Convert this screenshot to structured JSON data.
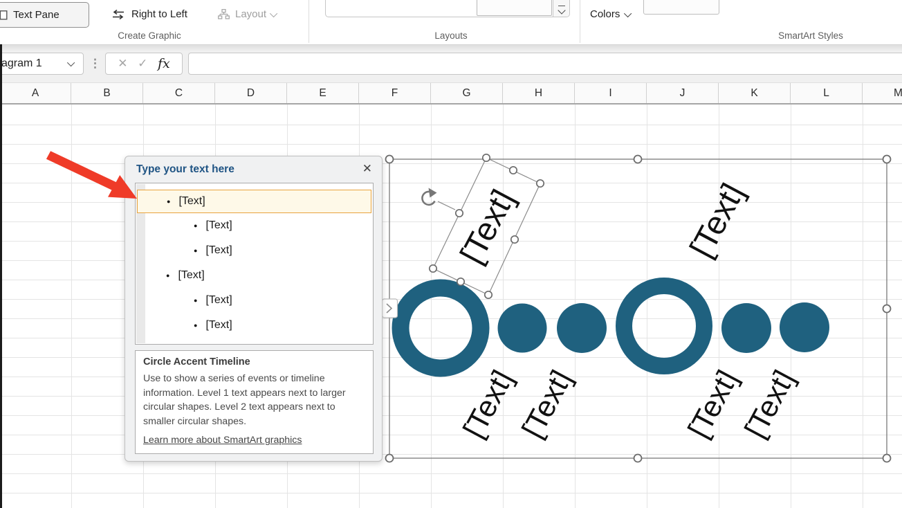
{
  "ribbon": {
    "create_graphic": {
      "text_pane_label": "Text Pane",
      "right_to_left_label": "Right to Left",
      "layout_label": "Layout",
      "group_label": "Create Graphic"
    },
    "layouts": {
      "group_label": "Layouts"
    },
    "smartart_styles": {
      "colors_label": "Colors",
      "group_label": "SmartArt Styles"
    }
  },
  "formula_bar": {
    "name_box_value": "agram 1",
    "cancel_glyph": "✕",
    "enter_glyph": "✓",
    "fx_glyph": "fx",
    "dots_glyph": "⋮",
    "formula_value": ""
  },
  "columns": [
    "A",
    "B",
    "C",
    "D",
    "E",
    "F",
    "G",
    "H",
    "I",
    "J",
    "K",
    "L",
    "M"
  ],
  "text_pane": {
    "title": "Type your text here",
    "close_glyph": "✕",
    "items": [
      {
        "level": 1,
        "text": "[Text]",
        "selected": true
      },
      {
        "level": 2,
        "text": "[Text]",
        "selected": false
      },
      {
        "level": 2,
        "text": "[Text]",
        "selected": false
      },
      {
        "level": 1,
        "text": "[Text]",
        "selected": false
      },
      {
        "level": 2,
        "text": "[Text]",
        "selected": false
      },
      {
        "level": 2,
        "text": "[Text]",
        "selected": false
      }
    ],
    "description": {
      "title": "Circle Accent Timeline",
      "body": "Use to show a series of events or timeline information. Level 1 text appears next to larger circular shapes. Level 2 text appears next to smaller circular shapes.",
      "link": "Learn more about SmartArt graphics"
    }
  },
  "smartart": {
    "labels": [
      "[Text]",
      "[Text]",
      "[Text]",
      "[Text]",
      "[Text]",
      "[Text]"
    ],
    "accent_color": "#1F617F"
  },
  "colors": {
    "accent_teal": "#1F617F",
    "selection_orange": "#E8A33D",
    "selection_fill": "#FEF9E8",
    "pane_title_blue": "#1F5484",
    "arrow_red": "#EF3B28"
  }
}
